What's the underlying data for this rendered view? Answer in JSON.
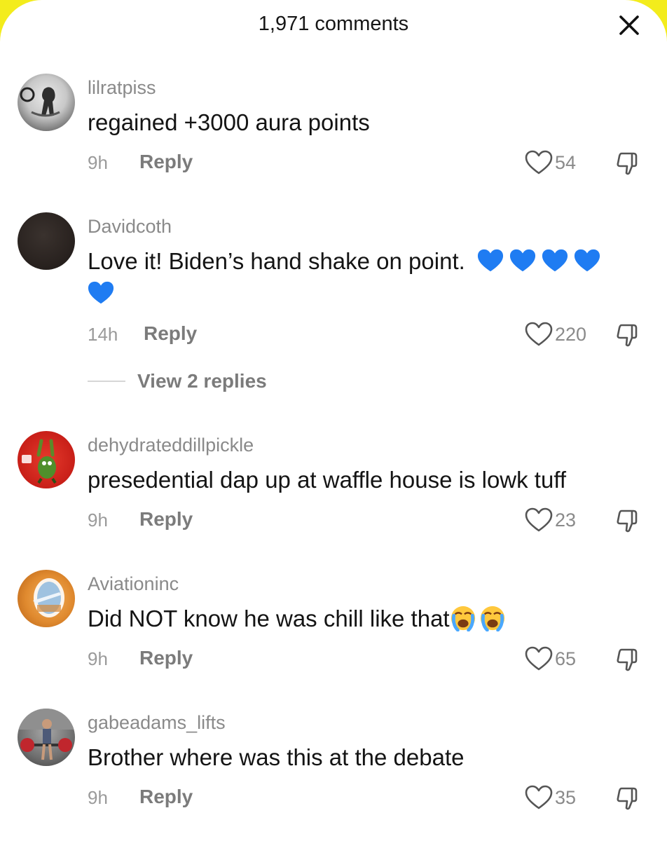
{
  "header": {
    "title": "1,971 comments",
    "close_icon": "close-icon"
  },
  "comments": [
    {
      "username": "lilratpiss",
      "text": "regained +3000 aura points",
      "time": "9h",
      "reply_label": "Reply",
      "likes": "54"
    },
    {
      "username": "Davidcoth",
      "text": "Love it! Biden’s hand shake on point.",
      "emojis": [
        "blue-heart",
        "blue-heart",
        "blue-heart",
        "blue-heart",
        "blue-heart"
      ],
      "time": "14h",
      "reply_label": "Reply",
      "likes": "220",
      "view_replies": "View 2 replies"
    },
    {
      "username": "dehydrateddillpickle",
      "text": "presedential dap up at waffle house is lowk tuff",
      "time": "9h",
      "reply_label": "Reply",
      "likes": "23"
    },
    {
      "username": "Aviationinc",
      "text": "Did NOT know he was chill like that",
      "emojis": [
        "loudly-crying-face",
        "loudly-crying-face"
      ],
      "time": "9h",
      "reply_label": "Reply",
      "likes": "65"
    },
    {
      "username": "gabeadams_lifts",
      "text": "Brother where was this at the debate",
      "time": "9h",
      "reply_label": "Reply",
      "likes": "35"
    }
  ],
  "colors": {
    "corner_accent": "#f3ec1c",
    "heart_emoji": "#1f7cf2",
    "muted_text": "#8a8a8a"
  }
}
